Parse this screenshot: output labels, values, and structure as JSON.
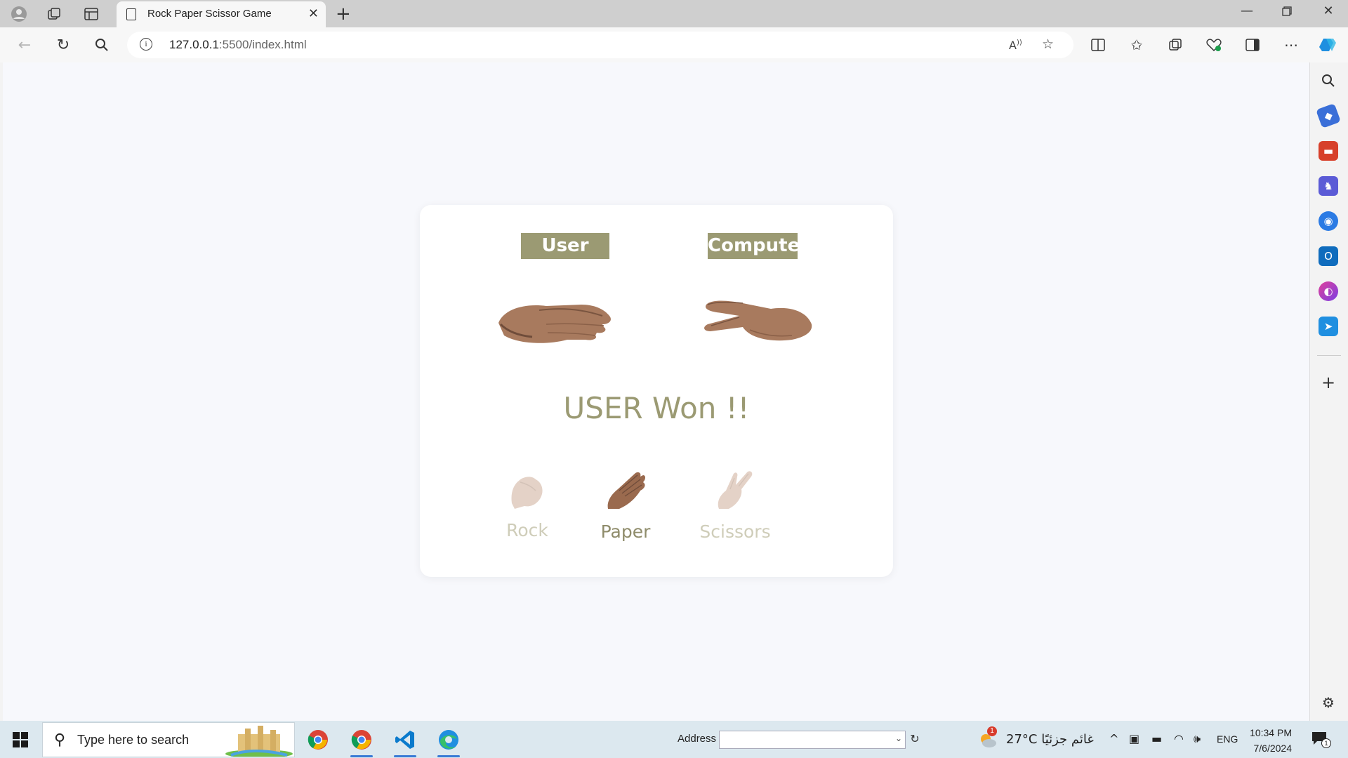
{
  "browser": {
    "tab_title": "Rock Paper Scissor Game",
    "url_host": "127.0.0.1",
    "url_path": ":5500/index.html"
  },
  "game": {
    "user_label": "User",
    "computer_label": "Computer",
    "user_hand": "paper",
    "computer_hand": "scissors",
    "result": "USER Won !!",
    "choices": [
      {
        "label": "Rock",
        "active": false
      },
      {
        "label": "Paper",
        "active": true
      },
      {
        "label": "Scissors",
        "active": false
      }
    ],
    "accent_color": "#9b9a73",
    "inactive_color": "#cfcdb9"
  },
  "taskbar": {
    "search_placeholder": "Type here to search",
    "address_label": "Address",
    "weather_badge": "1",
    "weather": "27°C  غائم جزئيًا",
    "language": "ENG",
    "time": "10:34 PM",
    "date": "7/6/2024",
    "notification_count": "1"
  }
}
